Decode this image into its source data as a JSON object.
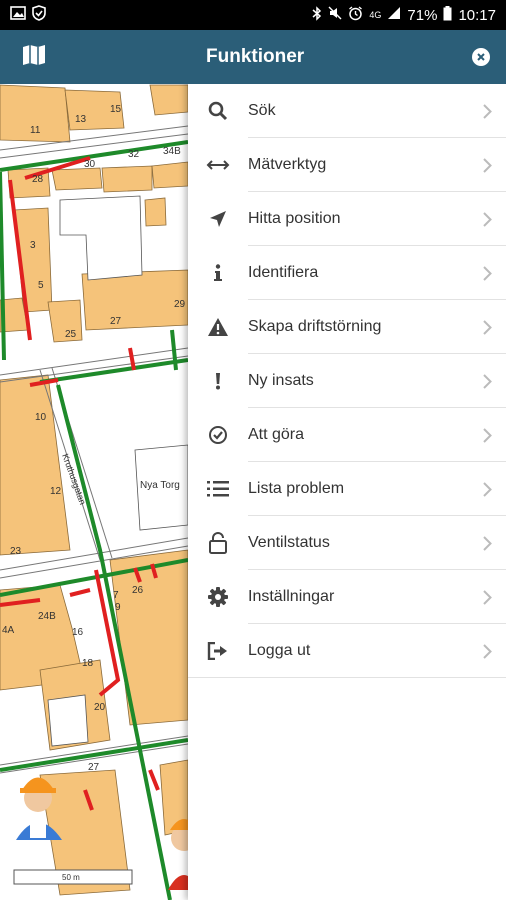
{
  "status_bar": {
    "battery": "71%",
    "time": "10:17",
    "signal_label": "4G"
  },
  "map": {
    "header_icon": "map-icon",
    "labels": {
      "house_11": "11",
      "house_13": "13",
      "house_15": "15",
      "house_28": "28",
      "house_30": "30",
      "house_32": "32",
      "house_34b": "34B",
      "house_3": "3",
      "house_5": "5",
      "house_25": "25",
      "house_27a": "27",
      "house_29": "29",
      "house_10": "10",
      "house_12": "12",
      "house_23": "23",
      "house_24a": "4A",
      "house_24b": "24B",
      "house_16": "16",
      "house_18": "18",
      "house_20": "20",
      "house_27b": "27",
      "house_7": "7",
      "house_9": "9",
      "house_26": "26",
      "street": "Kruthusgatan",
      "square": "Nya Torg",
      "scale": "50 m"
    }
  },
  "drawer": {
    "title": "Funktioner",
    "items": [
      {
        "label": "Sök",
        "icon": "search-icon"
      },
      {
        "label": "Mätverktyg",
        "icon": "measure-icon"
      },
      {
        "label": "Hitta position",
        "icon": "location-arrow-icon"
      },
      {
        "label": "Identifiera",
        "icon": "info-icon"
      },
      {
        "label": "Skapa driftstörning",
        "icon": "warning-icon"
      },
      {
        "label": "Ny insats",
        "icon": "exclamation-icon"
      },
      {
        "label": "Att göra",
        "icon": "check-circle-icon"
      },
      {
        "label": "Lista problem",
        "icon": "list-icon"
      },
      {
        "label": "Ventilstatus",
        "icon": "unlock-icon"
      },
      {
        "label": "Inställningar",
        "icon": "gear-icon"
      },
      {
        "label": "Logga ut",
        "icon": "logout-icon"
      }
    ]
  },
  "colors": {
    "header": "#2b5e78",
    "building": "#f5c37a",
    "pipe_green": "#1e8a2a",
    "pipe_red": "#e02020"
  }
}
